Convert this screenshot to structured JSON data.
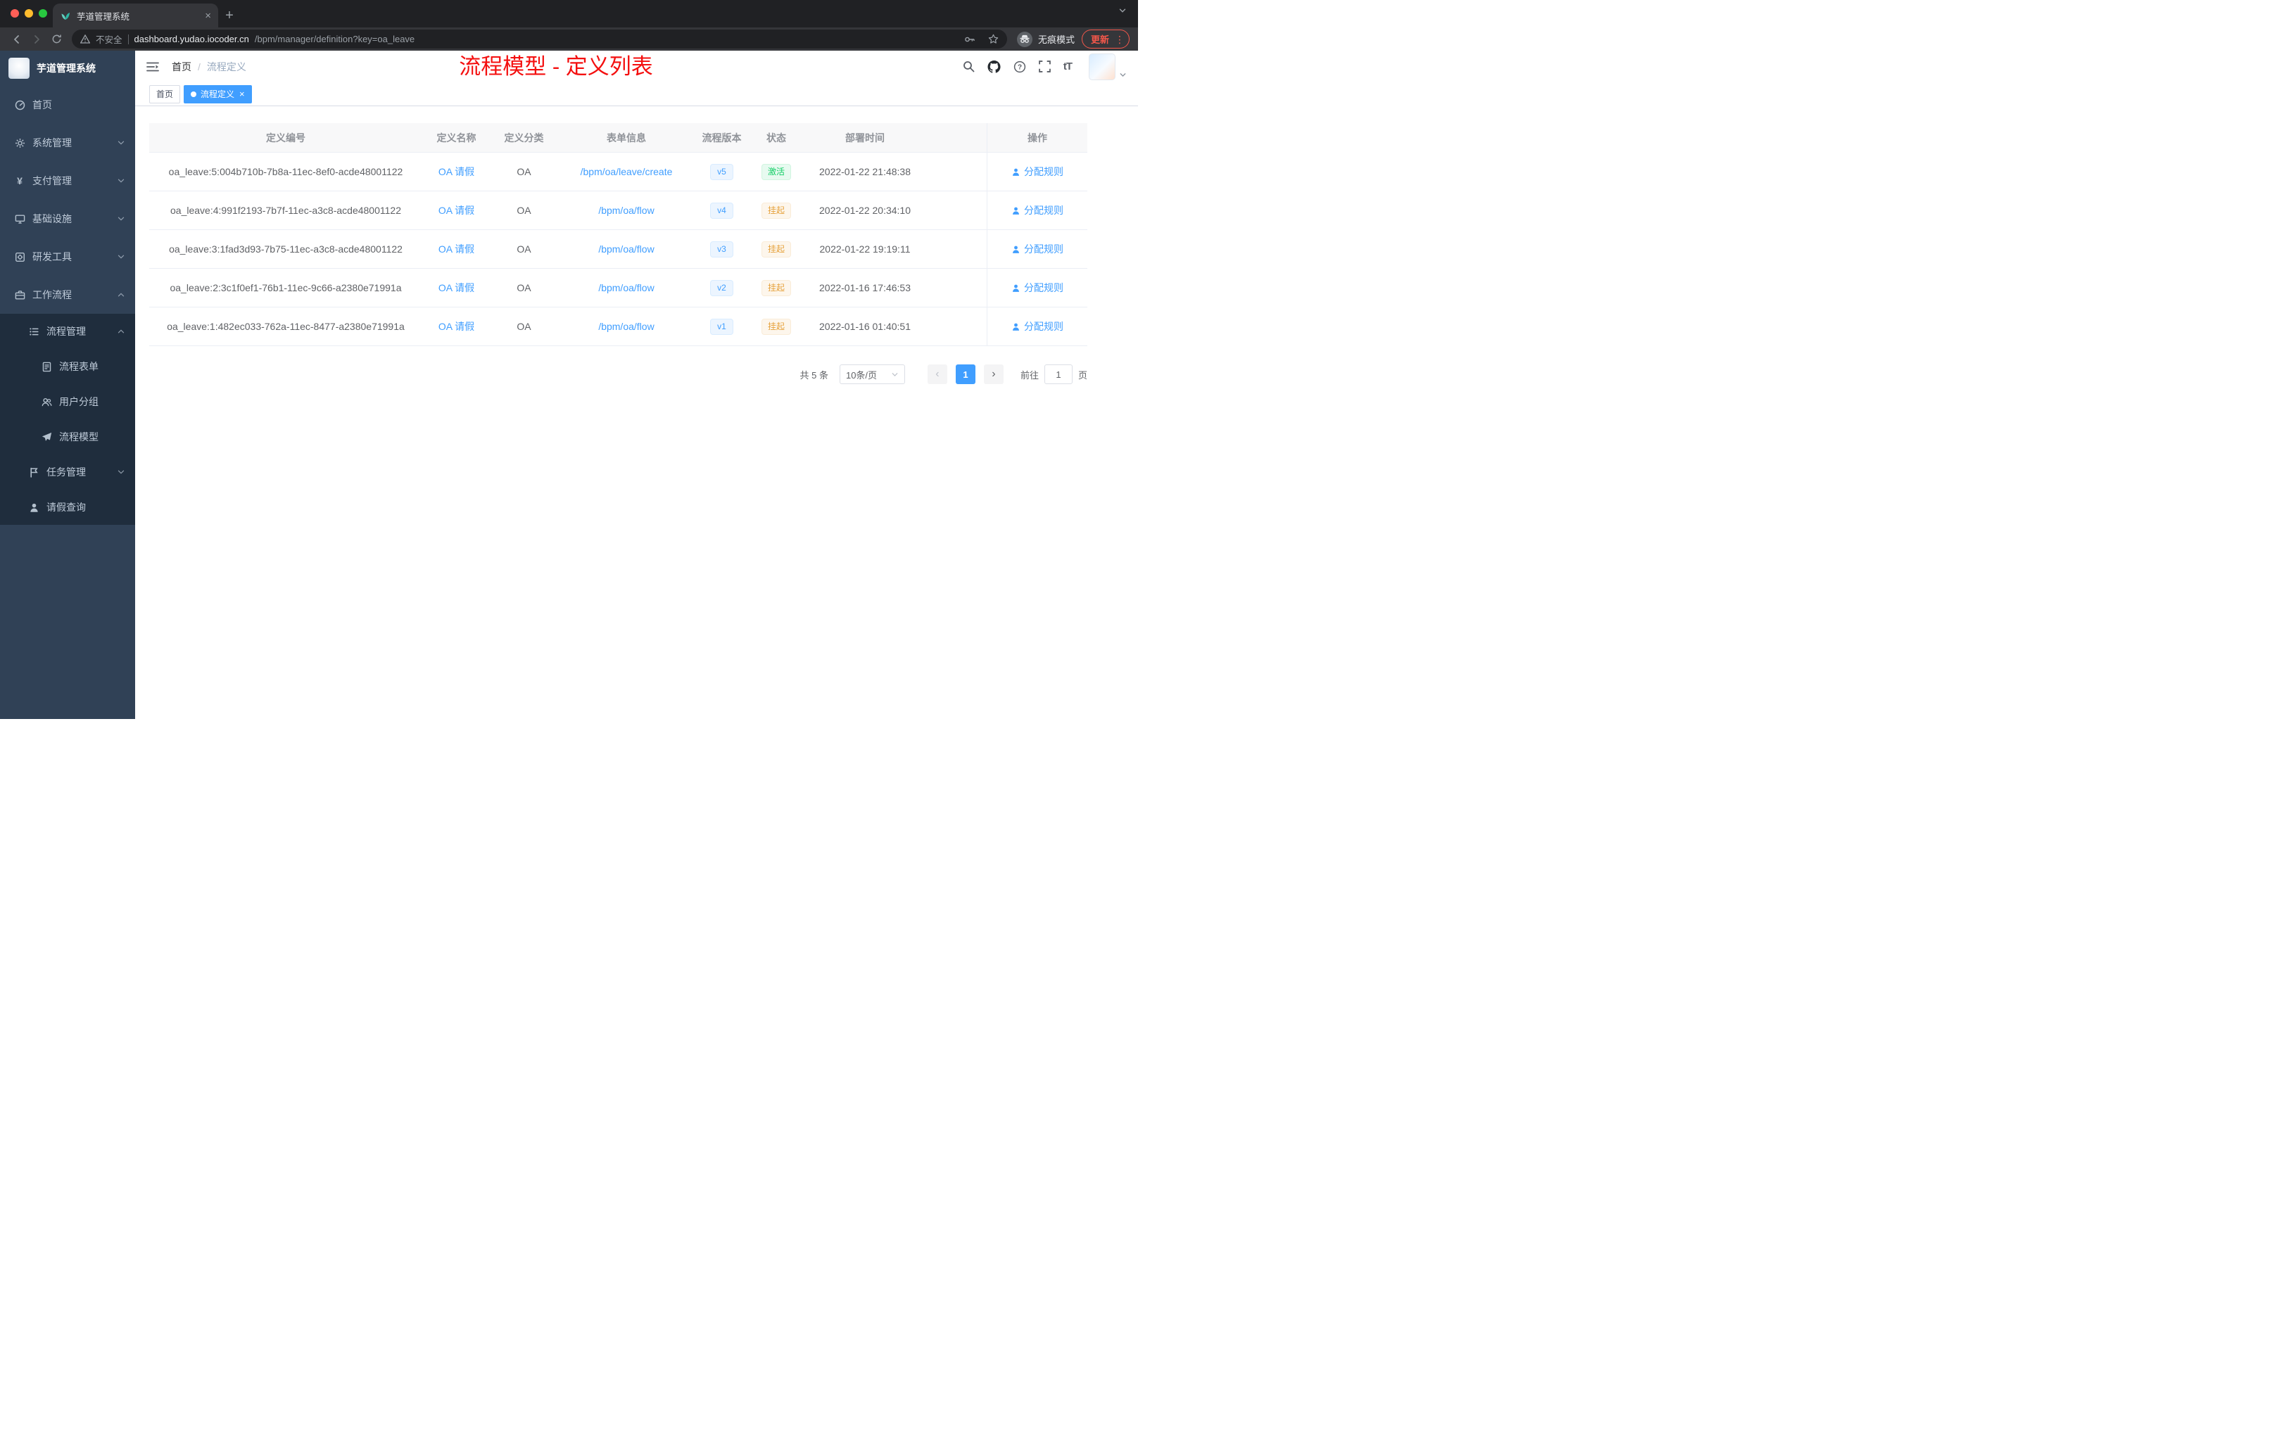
{
  "browser": {
    "tab": {
      "title": "芋道管理系统"
    },
    "toolbar": {
      "not_secure": "不安全",
      "url_host": "dashboard.yudao.iocoder.cn",
      "url_path": "/bpm/manager/definition?key=oa_leave",
      "incognito_label": "无痕模式",
      "update_label": "更新"
    }
  },
  "sidebar": {
    "logo_title": "芋道管理系统",
    "items": [
      {
        "key": "home",
        "label": "首页",
        "icon": "dashboard-icon",
        "level": 1
      },
      {
        "key": "system-management",
        "label": "系统管理",
        "icon": "gear-icon",
        "level": 1,
        "chevron": "down"
      },
      {
        "key": "payment-management",
        "label": "支付管理",
        "icon": "yen-icon",
        "level": 1,
        "chevron": "down"
      },
      {
        "key": "infrastructure",
        "label": "基础设施",
        "icon": "monitor-icon",
        "level": 1,
        "chevron": "down"
      },
      {
        "key": "dev-tools",
        "label": "研发工具",
        "icon": "toolbox-icon",
        "level": 1,
        "chevron": "down"
      },
      {
        "key": "workflow",
        "label": "工作流程",
        "icon": "briefcase-icon",
        "level": 1,
        "chevron": "up"
      },
      {
        "key": "process-management",
        "label": "流程管理",
        "icon": "list-icon",
        "level": 2,
        "chevron": "up",
        "dark": true
      },
      {
        "key": "process-form",
        "label": "流程表单",
        "icon": "form-icon",
        "level": 3,
        "dark": true
      },
      {
        "key": "user-group",
        "label": "用户分组",
        "icon": "users-icon",
        "level": 3,
        "dark": true
      },
      {
        "key": "process-model",
        "label": "流程模型",
        "icon": "paper-plane-icon",
        "level": 3,
        "dark": true
      },
      {
        "key": "task-management",
        "label": "任务管理",
        "icon": "flag-icon",
        "level": 2,
        "chevron": "down",
        "dark": true
      },
      {
        "key": "leave-query",
        "label": "请假查询",
        "icon": "person-icon",
        "level": 2,
        "dark": true
      }
    ]
  },
  "header": {
    "breadcrumb": [
      "首页",
      "流程定义"
    ],
    "annotation": "流程模型 - 定义列表"
  },
  "tags": [
    {
      "label": "首页",
      "active": false,
      "closable": false
    },
    {
      "label": "流程定义",
      "active": true,
      "closable": true
    }
  ],
  "table": {
    "columns": [
      "定义编号",
      "定义名称",
      "定义分类",
      "表单信息",
      "流程版本",
      "状态",
      "部署时间",
      "操作"
    ],
    "rows": [
      {
        "id": "oa_leave:5:004b710b-7b8a-11ec-8ef0-acde48001122",
        "name": "OA 请假",
        "category": "OA",
        "form": "/bpm/oa/leave/create",
        "version": "v5",
        "status": "激活",
        "status_type": "success",
        "deploy_time": "2022-01-22 21:48:38",
        "action": "分配规则"
      },
      {
        "id": "oa_leave:4:991f2193-7b7f-11ec-a3c8-acde48001122",
        "name": "OA 请假",
        "category": "OA",
        "form": "/bpm/oa/flow",
        "version": "v4",
        "status": "挂起",
        "status_type": "warning",
        "deploy_time": "2022-01-22 20:34:10",
        "action": "分配规则"
      },
      {
        "id": "oa_leave:3:1fad3d93-7b75-11ec-a3c8-acde48001122",
        "name": "OA 请假",
        "category": "OA",
        "form": "/bpm/oa/flow",
        "version": "v3",
        "status": "挂起",
        "status_type": "warning",
        "deploy_time": "2022-01-22 19:19:11",
        "action": "分配规则"
      },
      {
        "id": "oa_leave:2:3c1f0ef1-76b1-11ec-9c66-a2380e71991a",
        "name": "OA 请假",
        "category": "OA",
        "form": "/bpm/oa/flow",
        "version": "v2",
        "status": "挂起",
        "status_type": "warning",
        "deploy_time": "2022-01-16 17:46:53",
        "action": "分配规则"
      },
      {
        "id": "oa_leave:1:482ec033-762a-11ec-8477-a2380e71991a",
        "name": "OA 请假",
        "category": "OA",
        "form": "/bpm/oa/flow",
        "version": "v1",
        "status": "挂起",
        "status_type": "warning",
        "deploy_time": "2022-01-16 01:40:51",
        "action": "分配规则"
      }
    ]
  },
  "pagination": {
    "total": "共 5 条",
    "page_size": "10条/页",
    "current_page": "1",
    "goto_prefix": "前往",
    "goto_value": "1",
    "goto_suffix": "页"
  },
  "colors": {
    "accent_blue": "#409eff",
    "success_green": "#13ce66",
    "warning_orange": "#e6a23c",
    "annotation_red": "#f40f0f",
    "sidebar_bg": "#304156",
    "submenu_bg": "#1f2d3d"
  }
}
